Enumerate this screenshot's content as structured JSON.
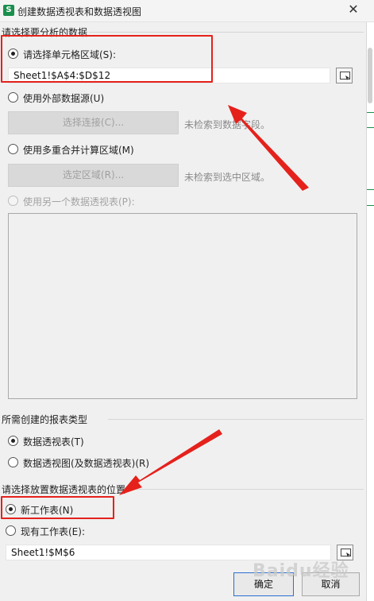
{
  "dialog": {
    "title": "创建数据透视表和数据透视图",
    "app_icon_glyph": "S",
    "close_glyph": "✕"
  },
  "source": {
    "header": "请选择要分析的数据",
    "option_range": "请选择单元格区域(S):",
    "range_value": "Sheet1!$A$4:$D$12",
    "option_external": "使用外部数据源(U)",
    "choose_connection": "选择连接(C)...",
    "no_fields_hint": "未检索到数据字段。",
    "option_consolidate": "使用多重合并计算区域(M)",
    "select_region": "选定区域(R)...",
    "no_region_hint": "未检索到选中区域。",
    "option_other_pivot": "使用另一个数据透视表(P):"
  },
  "report_type": {
    "header": "所需创建的报表类型",
    "option_pivot_table": "数据透视表(T)",
    "option_pivot_chart": "数据透视图(及数据透视表)(R)"
  },
  "placement": {
    "header": "请选择放置数据透视表的位置",
    "option_new_sheet": "新工作表(N)",
    "option_existing_sheet": "现有工作表(E):",
    "existing_value": "Sheet1!$M$6"
  },
  "buttons": {
    "ok": "确定",
    "cancel": "取消"
  },
  "watermark": "Baidu经验",
  "colors": {
    "annotation_red": "#e5211c",
    "brand_green": "#1b8f4e"
  },
  "icons": {
    "range_picker": "range-select-icon",
    "close": "close-icon"
  }
}
